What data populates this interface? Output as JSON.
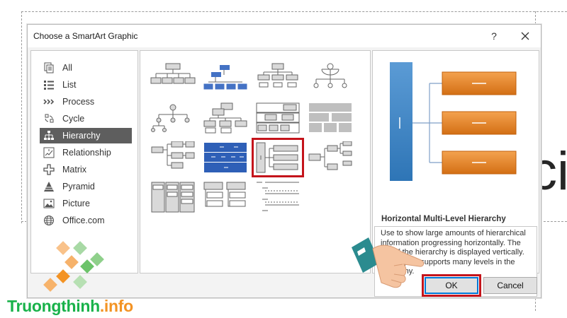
{
  "slide": {
    "background_text": "cit"
  },
  "dialog": {
    "title": "Choose a SmartArt Graphic",
    "help_label": "?",
    "categories": [
      {
        "label": "All",
        "icon": "all-icon"
      },
      {
        "label": "List",
        "icon": "list-icon"
      },
      {
        "label": "Process",
        "icon": "process-icon"
      },
      {
        "label": "Cycle",
        "icon": "cycle-icon"
      },
      {
        "label": "Hierarchy",
        "icon": "hierarchy-icon",
        "selected": true
      },
      {
        "label": "Relationship",
        "icon": "relationship-icon"
      },
      {
        "label": "Matrix",
        "icon": "matrix-icon"
      },
      {
        "label": "Pyramid",
        "icon": "pyramid-icon"
      },
      {
        "label": "Picture",
        "icon": "picture-icon"
      },
      {
        "label": "Office.com",
        "icon": "globe-icon"
      }
    ],
    "selected_layout": "Horizontal Multi-Level Hierarchy",
    "preview": {
      "title": "Horizontal Multi-Level Hierarchy",
      "description": "Use to show large amounts of hierarchical information progressing horizontally. The top of the hierarchy is displayed vertically. This layout supports many levels in the hierarchy."
    },
    "buttons": {
      "ok": "OK",
      "cancel": "Cancel"
    },
    "colors": {
      "accent_blue": "#2e75b6",
      "accent_orange": "#e36c0a",
      "highlight_red": "#c4141b",
      "selected_category": "#5e5e5e"
    }
  },
  "watermark": {
    "brand_part1": "Truongthinh",
    "brand_part2": ".info",
    "colors": {
      "green": "#19b24a",
      "orange": "#f39324"
    }
  }
}
